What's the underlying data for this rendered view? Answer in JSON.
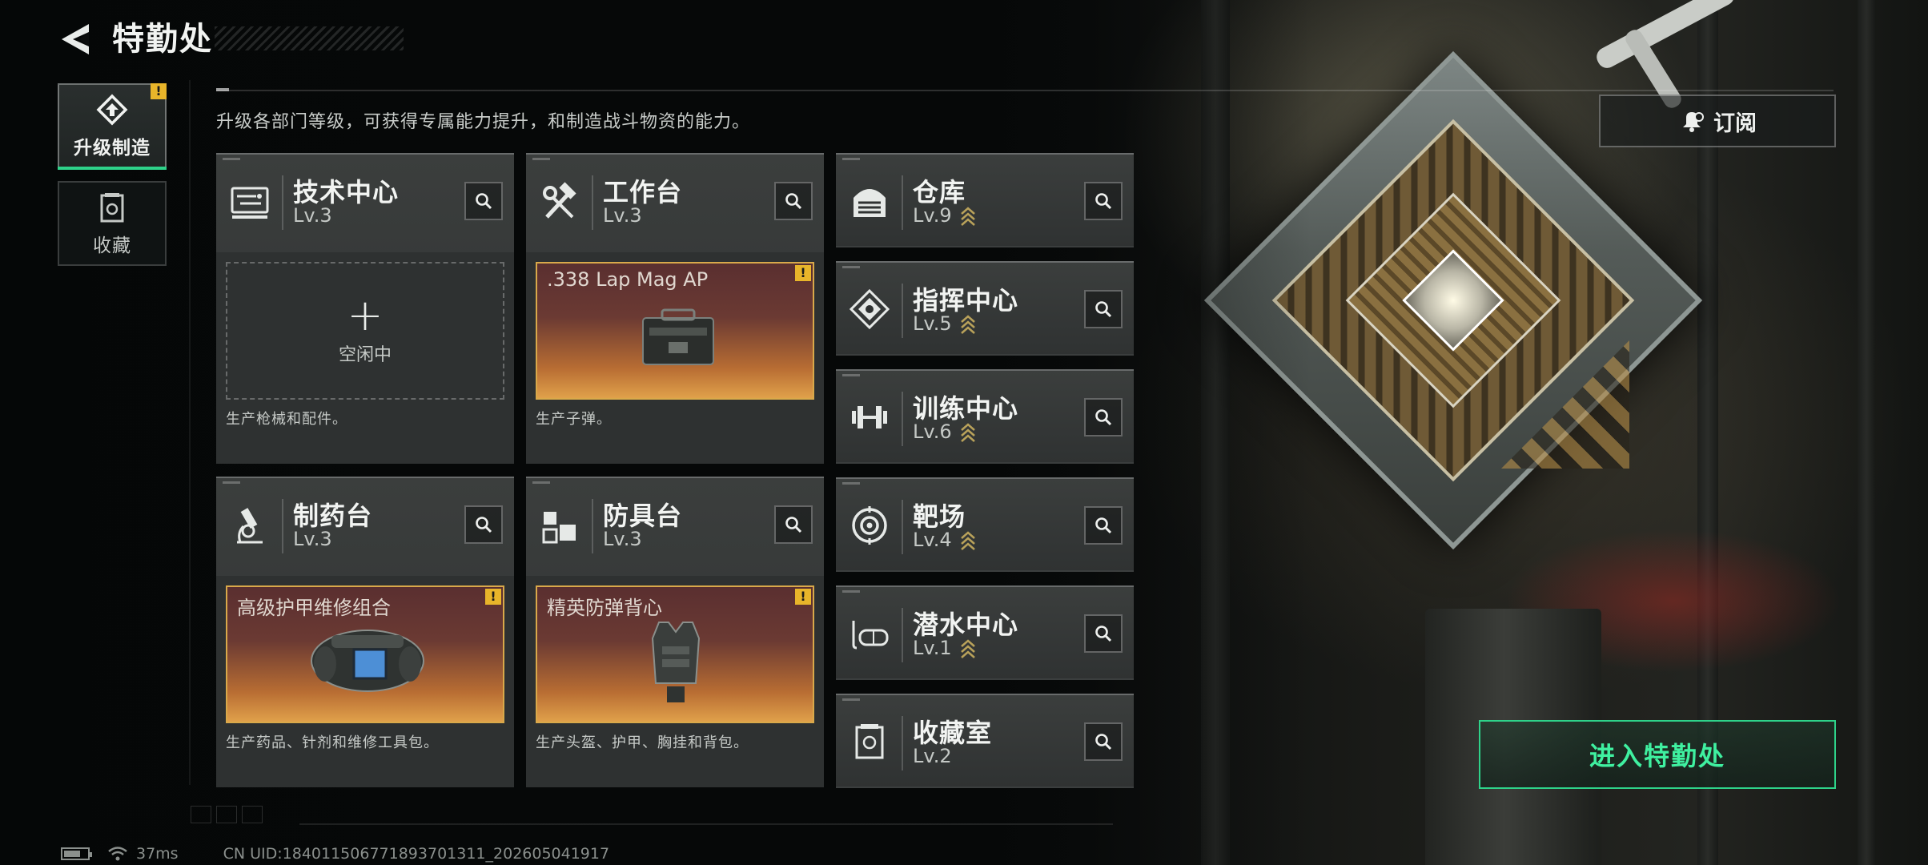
{
  "header": {
    "title": "特勤处"
  },
  "nav": {
    "items": [
      {
        "label": "升级制造",
        "active": true,
        "alert": "!"
      },
      {
        "label": "收藏",
        "active": false
      }
    ]
  },
  "description": "升级各部门等级，可获得专属能力提升，和制造战斗物资的能力。",
  "subscribe": {
    "label": "订阅"
  },
  "production_departments": [
    {
      "name": "技术中心",
      "level": "Lv.3",
      "slot": {
        "state": "empty",
        "plus": "+",
        "status": "空闲中"
      },
      "desc": "生产枪械和配件。"
    },
    {
      "name": "工作台",
      "level": "Lv.3",
      "slot": {
        "state": "item",
        "item_name": ".338 Lap Mag AP",
        "alert": "!"
      },
      "desc": "生产子弹。"
    },
    {
      "name": "制药台",
      "level": "Lv.3",
      "slot": {
        "state": "item",
        "item_name": "高级护甲维修组合",
        "alert": "!"
      },
      "desc": "生产药品、针剂和维修工具包。"
    },
    {
      "name": "防具台",
      "level": "Lv.3",
      "slot": {
        "state": "item",
        "item_name": "精英防弹背心",
        "alert": "!"
      },
      "desc": "生产头盔、护甲、胸挂和背包。"
    }
  ],
  "facility_departments": [
    {
      "name": "仓库",
      "level": "Lv.9",
      "upgradable": true
    },
    {
      "name": "指挥中心",
      "level": "Lv.5",
      "upgradable": true
    },
    {
      "name": "训练中心",
      "level": "Lv.6",
      "upgradable": true
    },
    {
      "name": "靶场",
      "level": "Lv.4",
      "upgradable": true
    },
    {
      "name": "潜水中心",
      "level": "Lv.1",
      "upgradable": true
    },
    {
      "name": "收藏室",
      "level": "Lv.2",
      "upgradable": false
    }
  ],
  "enter_button": {
    "label": "进入特勤处"
  },
  "status_bar": {
    "ping": "37ms",
    "uid": "CN UID:1840115067718937013​11_202605041917"
  },
  "colors": {
    "accent_green": "#2ed38a",
    "alert_yellow": "#e8b52a",
    "item_border": "#d9a94a",
    "chevron": "#b9a25a"
  }
}
